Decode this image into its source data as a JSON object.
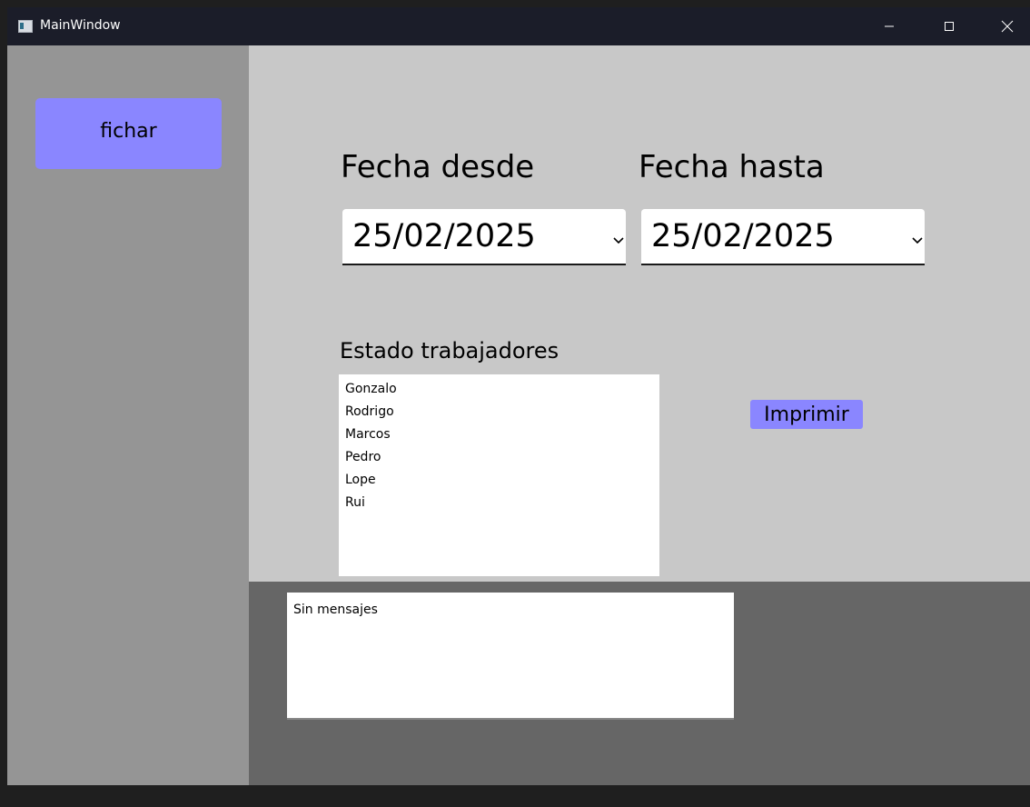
{
  "window": {
    "title": "MainWindow"
  },
  "sidebar": {
    "fichar_label": "fichar"
  },
  "filters": {
    "from_label": "Fecha desde",
    "from_value": "25/02/2025",
    "to_label": "Fecha hasta",
    "to_value": "25/02/2025"
  },
  "workers": {
    "title": "Estado trabajadores",
    "items": [
      "Gonzalo",
      "Rodrigo",
      "Marcos",
      "Pedro",
      "Lope",
      "Rui"
    ]
  },
  "actions": {
    "print_label": "Imprimir"
  },
  "messages": {
    "text": "Sin mensajes"
  },
  "colors": {
    "accent_button": "#8a86ff",
    "sidebar_bg": "#959595",
    "main_bg": "#c8c8c8",
    "bottom_bg": "#666666",
    "titlebar_bg": "#1b1d29"
  },
  "icons": {
    "window_controls": [
      "minimize-icon",
      "maximize-icon",
      "close-icon"
    ],
    "datepicker": "chevron-down-icon"
  }
}
